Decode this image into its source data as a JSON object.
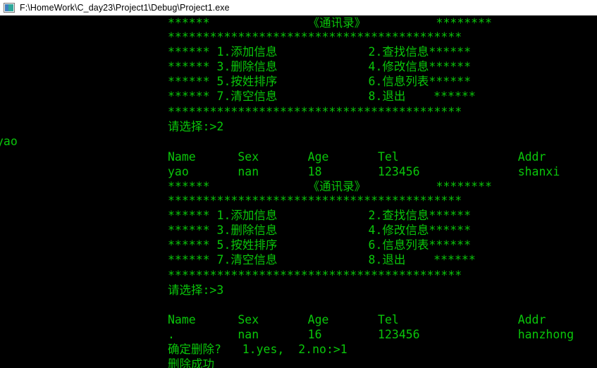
{
  "window": {
    "title": "F:\\HomeWork\\C_day23\\Project1\\Debug\\Project1.exe",
    "icon": "console-app-icon"
  },
  "colors": {
    "console_background": "#000000",
    "console_text": "#0ac60a",
    "titlebar_background": "#ffffff",
    "titlebar_text": "#000000"
  },
  "console": {
    "menu_title_line": "******              《通讯录》          ********",
    "separator_line": "******************************************",
    "menu_items": [
      "****** 1.添加信息             2.查找信息******",
      "****** 3.删除信息             4.修改信息******",
      "****** 5.按姓排序             6.信息列表******",
      "****** 7.清空信息             8.退出    ******"
    ],
    "prompt_choice_2": "请选择:>2",
    "prompt_choice_3": "请选择:>3",
    "stray_left_text": "yao",
    "table_header": "Name      Sex       Age       Tel                 Addr",
    "record_1": "yao       nan       18        123456              shanxi",
    "record_2": ".         nan       16        123456              hanzhong",
    "confirm_delete": "确定删除?   1.yes,  2.no:>1",
    "delete_success": "删除成功",
    "table_columns": [
      "Name",
      "Sex",
      "Age",
      "Tel",
      "Addr"
    ],
    "records": [
      {
        "name": "yao",
        "sex": "nan",
        "age": "18",
        "tel": "123456",
        "addr": "shanxi"
      },
      {
        "name": ".",
        "sex": "nan",
        "age": "16",
        "tel": "123456",
        "addr": "hanzhong"
      }
    ]
  }
}
